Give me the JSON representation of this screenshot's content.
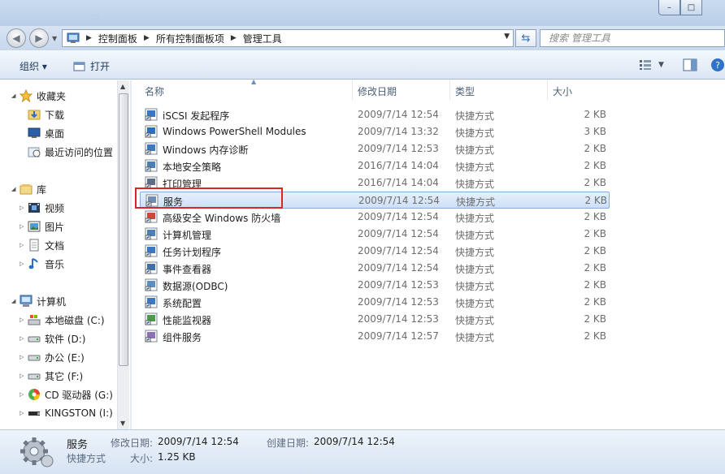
{
  "window": {
    "title_ghost": "...",
    "minimize": "–",
    "maximize": "□"
  },
  "address": {
    "crumbs": [
      "控制面板",
      "所有控制面板项",
      "管理工具"
    ],
    "search_placeholder": "搜索 管理工具"
  },
  "toolbar": {
    "organize_label": "组织 ▾",
    "open_label": "打开"
  },
  "nav": {
    "favorites": "收藏夹",
    "downloads": "下载",
    "desktop": "桌面",
    "recent": "最近访问的位置",
    "libraries": "库",
    "videos": "视频",
    "pictures": "图片",
    "documents": "文档",
    "music": "音乐",
    "computer": "计算机",
    "drive_c": "本地磁盘 (C:)",
    "drive_d": "软件 (D:)",
    "drive_e": "办公 (E:)",
    "drive_f": "其它 (F:)",
    "drive_g": "CD 驱动器 (G:)",
    "drive_i": "KINGSTON (I:)"
  },
  "columns": {
    "name": "名称",
    "date": "修改日期",
    "type": "类型",
    "size": "大小"
  },
  "files": [
    {
      "name": "iSCSI 发起程序",
      "date": "2009/7/14 12:54",
      "type": "快捷方式",
      "size": "2 KB"
    },
    {
      "name": "Windows PowerShell Modules",
      "date": "2009/7/14 13:32",
      "type": "快捷方式",
      "size": "3 KB"
    },
    {
      "name": "Windows 内存诊断",
      "date": "2009/7/14 12:53",
      "type": "快捷方式",
      "size": "2 KB"
    },
    {
      "name": "本地安全策略",
      "date": "2016/7/14 14:04",
      "type": "快捷方式",
      "size": "2 KB"
    },
    {
      "name": "打印管理",
      "date": "2016/7/14 14:04",
      "type": "快捷方式",
      "size": "2 KB"
    },
    {
      "name": "服务",
      "date": "2009/7/14 12:54",
      "type": "快捷方式",
      "size": "2 KB"
    },
    {
      "name": "高级安全 Windows 防火墙",
      "date": "2009/7/14 12:54",
      "type": "快捷方式",
      "size": "2 KB"
    },
    {
      "name": "计算机管理",
      "date": "2009/7/14 12:54",
      "type": "快捷方式",
      "size": "2 KB"
    },
    {
      "name": "任务计划程序",
      "date": "2009/7/14 12:54",
      "type": "快捷方式",
      "size": "2 KB"
    },
    {
      "name": "事件查看器",
      "date": "2009/7/14 12:54",
      "type": "快捷方式",
      "size": "2 KB"
    },
    {
      "name": "数据源(ODBC)",
      "date": "2009/7/14 12:53",
      "type": "快捷方式",
      "size": "2 KB"
    },
    {
      "name": "系统配置",
      "date": "2009/7/14 12:53",
      "type": "快捷方式",
      "size": "2 KB"
    },
    {
      "name": "性能监视器",
      "date": "2009/7/14 12:53",
      "type": "快捷方式",
      "size": "2 KB"
    },
    {
      "name": "组件服务",
      "date": "2009/7/14 12:57",
      "type": "快捷方式",
      "size": "2 KB"
    }
  ],
  "selected_index": 5,
  "details": {
    "name": "服务",
    "type": "快捷方式",
    "modified_label": "修改日期:",
    "modified_value": "2009/7/14 12:54",
    "created_label": "创建日期:",
    "created_value": "2009/7/14 12:54",
    "size_label": "大小:",
    "size_value": "1.25 KB"
  },
  "colors": {
    "highlight_border": "#e02424",
    "selection_fill": "#cde0f7",
    "chrome_blue": "#c7d8ed"
  }
}
